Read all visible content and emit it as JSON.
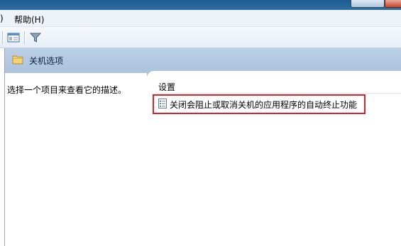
{
  "menubar": {
    "partial_item_label": ")",
    "help_label": "帮助(H)"
  },
  "toolbar": {
    "buttons": [
      {
        "icon": "properties-icon"
      },
      {
        "icon": "filter-icon"
      }
    ]
  },
  "header": {
    "title": "关机选项",
    "icon": "folder-icon"
  },
  "description": {
    "text": "选择一个项目来查看它的描述。"
  },
  "settings": {
    "column_header": "设置",
    "items": [
      {
        "label": "关闭会阻止或取消关机的应用程序的自动终止功能",
        "icon": "policy-setting-icon"
      }
    ]
  },
  "annotation": {
    "highlight_color": "#d8232a"
  }
}
